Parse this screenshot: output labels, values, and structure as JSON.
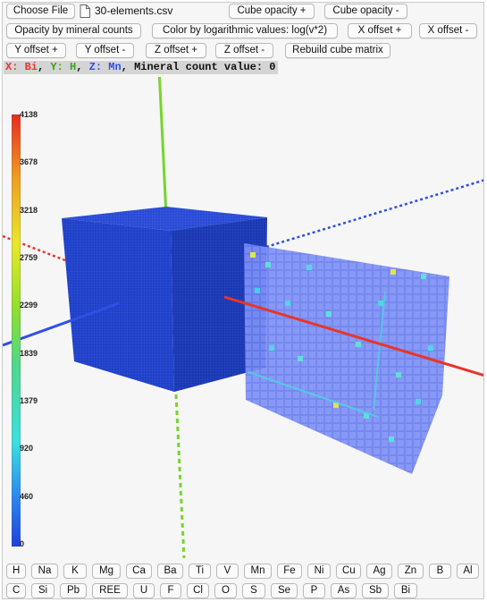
{
  "toolbar": {
    "choose_file": "Choose File",
    "file_name": "30-elements.csv",
    "cube_opacity_plus": "Cube opacity +",
    "cube_opacity_minus": "Cube opacity -",
    "opacity_by_counts": "Opacity by mineral counts",
    "color_by_log": "Color by logarithmic values: log(v*2)",
    "x_offset_plus": "X offset +",
    "x_offset_minus": "X offset -",
    "y_offset_plus": "Y offset +",
    "y_offset_minus": "Y offset -",
    "z_offset_plus": "Z offset +",
    "z_offset_minus": "Z offset -",
    "rebuild": "Rebuild cube matrix"
  },
  "axis_caption": {
    "x_label": "X: Bi",
    "y_label": "Y: H",
    "z_label": "Z: Mn",
    "separator": ", ",
    "value_label": "Mineral count value: 0"
  },
  "colorbar": {
    "ticks": [
      "4138",
      "3678",
      "3218",
      "2759",
      "2299",
      "1839",
      "1379",
      "920",
      "460",
      "0"
    ],
    "min": 0,
    "max": 4138,
    "colors": [
      "#1f3fe0",
      "#2a8cf0",
      "#39e0e0",
      "#5fe07a",
      "#8fe02a",
      "#e8e82a",
      "#f0a020",
      "#e82a1f"
    ]
  },
  "axis_colors": {
    "x": "#e8352a",
    "y": "#74d62a",
    "z": "#2f4fe8"
  },
  "elements": {
    "row1": [
      "H",
      "Na",
      "K",
      "Mg",
      "Ca",
      "Ba",
      "Ti",
      "V",
      "Mn",
      "Fe",
      "Ni",
      "Cu",
      "Ag",
      "Zn",
      "B",
      "Al"
    ],
    "row2": [
      "C",
      "Si",
      "Pb",
      "REE",
      "U",
      "F",
      "Cl",
      "O",
      "S",
      "Se",
      "P",
      "As",
      "Sb",
      "Bi"
    ]
  }
}
